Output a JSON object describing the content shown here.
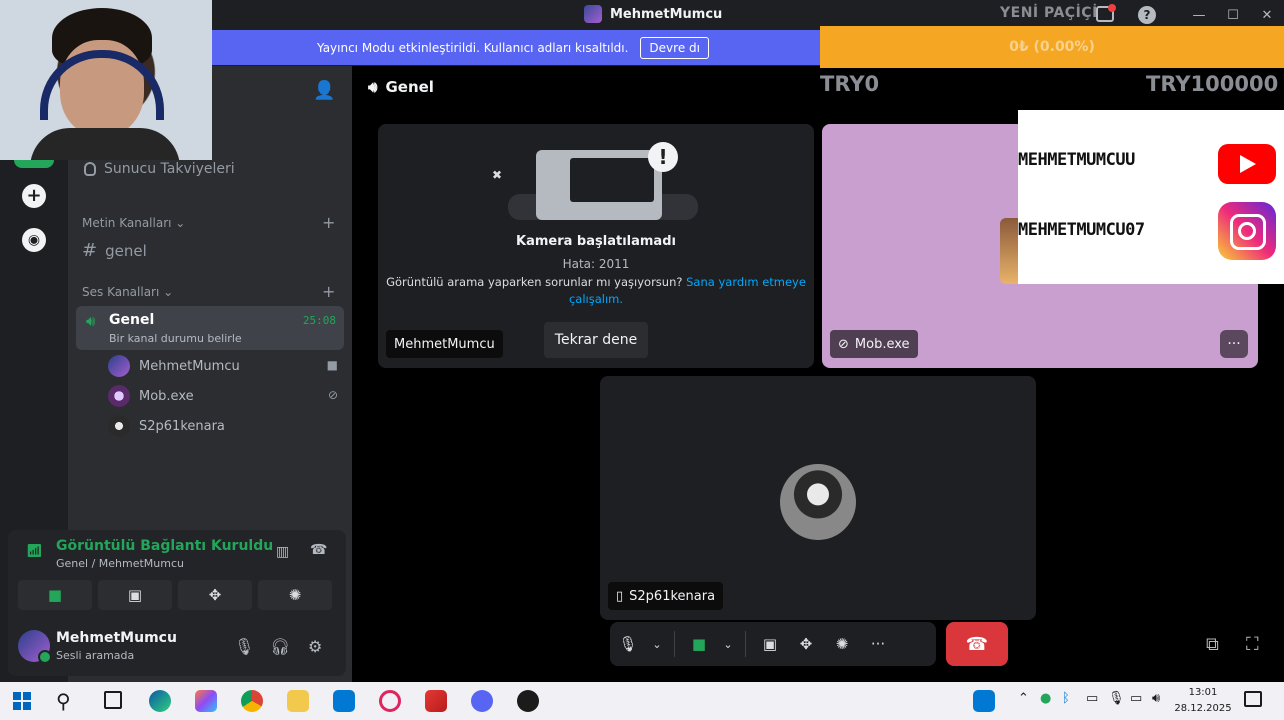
{
  "window": {
    "title": "MehmetMumcu",
    "controls": [
      "—",
      "☐",
      "✕"
    ],
    "help_icon": "?"
  },
  "banner": {
    "text": "Yayıncı Modu etkinleştirildi. Kullanıcı adları kısaltıldı.",
    "button_label": "Devre dı"
  },
  "overlay": {
    "yeni_text": "YENİ PAÇİÇİ",
    "donation": "0₺ (0.00%)",
    "donation_progress": 0,
    "try_left": "TRY0",
    "try_right": "TRY100000",
    "youtube_name": "MEHMETMUMCUU",
    "instagram_name": "MEHMETMUMCU07"
  },
  "sidebar": {
    "boost_label": "Sunucu Takviyeleri",
    "text_category": "Metin Kanalları",
    "text_channel": "genel",
    "voice_category": "Ses Kanalları",
    "voice_channel": {
      "name": "Genel",
      "status": "Bir kanal durumu belirle",
      "timer": "25:08"
    },
    "members": [
      {
        "name": "MehmetMumcu",
        "icon": "video-icon"
      },
      {
        "name": "Mob.exe",
        "icon": "mic-muted-icon"
      },
      {
        "name": "S2p61kenara",
        "icon": ""
      }
    ]
  },
  "rtc": {
    "title": "Görüntülü Bağlantı Kuruldu",
    "subtitle": "Genel / MehmetMumcu"
  },
  "user": {
    "name": "MehmetMumcu",
    "status": "Sesli aramada"
  },
  "main": {
    "channel": "Genel",
    "camera_error": {
      "title": "Kamera başlatılamadı",
      "code": "Hata: 2011",
      "help_text": "Görüntülü arama yaparken sorunlar mı yaşıyorsun?",
      "help_link": "Sana yardım etmeye çalışalım.",
      "retry_label": "Tekrar dene"
    },
    "tiles": [
      {
        "name": "MehmetMumcu"
      },
      {
        "name": "Mob.exe"
      },
      {
        "name": "S2p61kenara"
      }
    ]
  },
  "taskbar": {
    "time": "13:01",
    "date": "28.12.2025"
  },
  "colors": {
    "blurple": "#5865f2",
    "green": "#23a55a",
    "red": "#da373c",
    "donation": "#f5a623"
  }
}
